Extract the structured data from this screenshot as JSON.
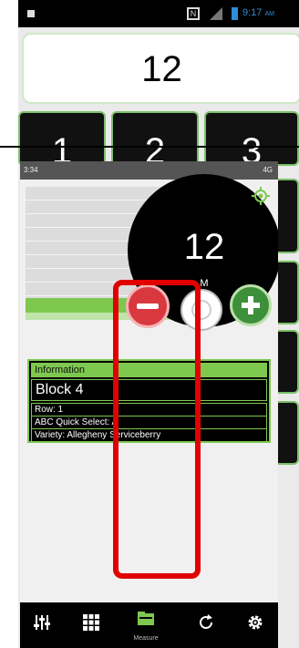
{
  "back_status": {
    "time": "9:17",
    "ampm": "AM",
    "nfc": "N"
  },
  "display": {
    "value": "12"
  },
  "keypad": {
    "keys": [
      "1",
      "2",
      "3"
    ]
  },
  "front_status": {
    "time": "3:34",
    "right": "4G"
  },
  "measure": {
    "value": "12",
    "unit": "M"
  },
  "info": {
    "header": "Information",
    "block": "Block 4",
    "row": "Row: 1",
    "quick_select": "ABC Quick Select: A",
    "variety": "Variety: Allegheny Serviceberry"
  },
  "nav": {
    "items": [
      {
        "icon": "sliders-icon",
        "label": ""
      },
      {
        "icon": "grid-icon",
        "label": ""
      },
      {
        "icon": "folder-icon",
        "label": "Measure"
      },
      {
        "icon": "refresh-icon",
        "label": ""
      },
      {
        "icon": "gear-icon",
        "label": ""
      }
    ]
  },
  "colors": {
    "accent_green": "#7ec850",
    "minus_red": "#d9383e",
    "plus_green": "#3e8f3a",
    "highlight": "#e00000"
  }
}
